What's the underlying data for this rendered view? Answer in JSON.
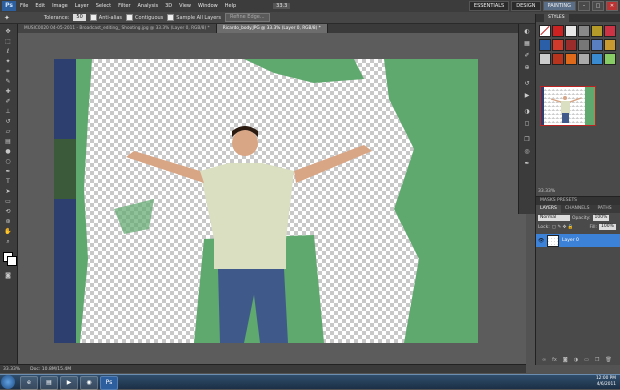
{
  "menubar": {
    "logo": "Ps",
    "items": [
      "File",
      "Edit",
      "Image",
      "Layer",
      "Select",
      "Filter",
      "Analysis",
      "3D",
      "View",
      "Window",
      "Help"
    ],
    "zoom_value": "33.3",
    "workspaces": [
      "ESSENTIALS",
      "DESIGN",
      "PAINTING"
    ],
    "active_workspace": "PAINTING",
    "cs_live": "CS Live"
  },
  "options": {
    "tolerance_label": "Tolerance:",
    "tolerance_value": "50",
    "anti_alias": "Anti-alias",
    "contiguous": "Contiguous",
    "sample_all": "Sample All Layers",
    "refine_edge": "Refine Edge..."
  },
  "tabs": [
    {
      "label": "MUSIC0020 04-05-2011 - Broadcast_editing_ Shooting.jpg @ 33.3% (Layer 0, RGB/8) *",
      "active": false
    },
    {
      "label": "Ricardo_body.JPG @ 33.3% (Layer 0, RGB/8) *",
      "active": true
    }
  ],
  "status": {
    "zoom": "33.33%",
    "doc": "Doc: 10.8M/15.4M"
  },
  "panels": {
    "styles_tabs": [
      "",
      "STYLES"
    ],
    "swatch_colors": [
      "#c22",
      "#e8e8e8",
      "#888",
      "#b59a2a",
      "#c34",
      "#2b5fa8",
      "#d03a2a",
      "#9a2c2c",
      "#777",
      "#5a7fc0",
      "#c89a30",
      "#ccc",
      "#b8341c",
      "#e06a1c",
      "#aaa",
      "#3a8ad0",
      "#8c6",
      "#e8c040"
    ],
    "nav_zoom": "33.33%",
    "layers_header": "MASKS  PRESETS",
    "layers_tabs": [
      "LAYERS",
      "CHANNELS",
      "PATHS"
    ],
    "blend_mode": "Normal",
    "opacity_label": "Opacity:",
    "opacity_value": "100%",
    "lock_label": "Lock:",
    "fill_label": "Fill:",
    "fill_value": "100%",
    "layer_name": "Layer 0"
  },
  "taskbar": {
    "time": "12:00 PM",
    "date": "4/6/2011"
  }
}
